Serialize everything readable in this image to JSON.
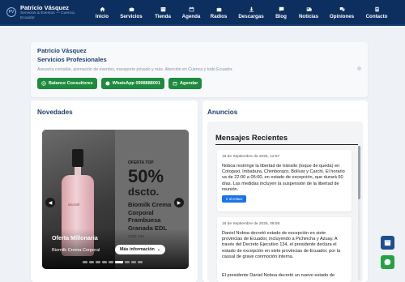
{
  "brand": {
    "name": "Patricio Vásquez",
    "subtitle_line1": "Servicios & Eventos — Cuenca,",
    "subtitle_line2": "Ecuador"
  },
  "nav": [
    {
      "label": "Inicio",
      "icon": "home-icon"
    },
    {
      "label": "Servicios",
      "icon": "briefcase-icon"
    },
    {
      "label": "Tienda",
      "icon": "store-icon"
    },
    {
      "label": "Agenda",
      "icon": "calendar-icon"
    },
    {
      "label": "Radios",
      "icon": "radio-icon"
    },
    {
      "label": "Descargas",
      "icon": "download-icon"
    },
    {
      "label": "Blog",
      "icon": "rss-icon"
    },
    {
      "label": "Noticias",
      "icon": "newspaper-icon"
    },
    {
      "label": "Opiniones",
      "icon": "comments-icon"
    },
    {
      "label": "Contacto",
      "icon": "contact-card-icon"
    }
  ],
  "hero": {
    "name": "Patricio Vásquez",
    "title": "Servicios Profesionales",
    "description": "Asesoría contable, animación de eventos, transporte privado y más. Atención en Cuenca y todo Ecuador.",
    "buttons": [
      {
        "label": "Balance Consultores",
        "icon": "globe-icon"
      },
      {
        "label": "WhatsApp 0998888001",
        "icon": "whatsapp-icon"
      },
      {
        "label": "Agendar",
        "icon": "calendar-icon"
      }
    ]
  },
  "novedades": {
    "title": "Novedades",
    "slide": {
      "offer_top": "OFERTA TOP",
      "offer_pct": "50%",
      "offer_dscto": "dscto.",
      "product_line1": "Biomilk Crema",
      "product_line2": "Corporal",
      "product_line3": "Frambuesa",
      "product_line4": "Granada EDL",
      "small": "CÓD: 244",
      "bottle_label": "Biomilk",
      "caption": "Oferta Millonaria",
      "subcaption": "Biomilk Crema Corporal",
      "more_button": "Más información",
      "prev_icon": "chevron-left-icon",
      "next_icon": "chevron-right-icon"
    },
    "dots": 9,
    "active_dot": 5
  },
  "anuncios": {
    "title": "Anuncios",
    "panel_title": "Mensajes Recientes",
    "messages": [
      {
        "date": "19 de Septiembre de 2025, 12:57",
        "body": "Noboa restringe la libertad de tránsito (toque de queda) en Cotopaxi, Imbabura, Chimborazo, Bolívar y Carchi. El horario va de 22:00 a 05:00, en estado de excepción, que durará 60 días. Las medidas incluyen la suspensión de la libertad de reunión.",
        "link_label": "Ir al enlace"
      },
      {
        "date": "16 de Septiembre de 2025, 08:58",
        "body": "Daniel Noboa decretó estado de excepción en siete provincias de Ecuador, incluyendo a Pichincha y Azuay. A través del Decreto Ejecutivo 134, el presidente declara el estado de excepción en siete provincias de Ecuador, por la causal de grave conmoción interna.",
        "body2": "El presidente Daniel Noboa decretó un nuevo estado de"
      }
    ]
  },
  "fabs": [
    {
      "icon": "store-icon"
    },
    {
      "icon": "whatsapp-icon"
    }
  ],
  "colors": {
    "nav_bg": "#0d2f5f",
    "heading": "#1f3f6e",
    "green": "#1e8a3e",
    "link_blue": "#1a73e8"
  }
}
